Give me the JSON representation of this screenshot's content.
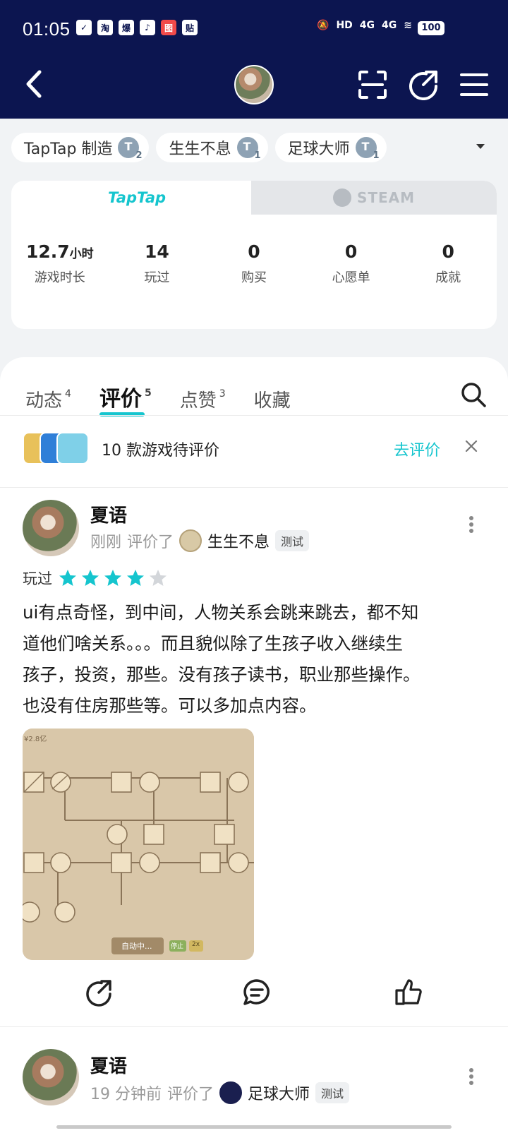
{
  "status_bar": {
    "time": "01:05",
    "app_icons": [
      "淘",
      "爆",
      "♪",
      "图",
      "贴"
    ],
    "network": "4G",
    "battery": "100"
  },
  "nav": {
    "back_icon": "chevron-left-icon",
    "avatar_icon": "avatar",
    "scan_icon": "scan-icon",
    "share_icon": "share-icon",
    "menu_icon": "menu-icon"
  },
  "game_chips": [
    {
      "label": "TapTap 制造",
      "badge": "2"
    },
    {
      "label": "生生不息",
      "badge": "1"
    },
    {
      "label": "足球大师",
      "badge": "1"
    }
  ],
  "platform": {
    "tab_taptap": "TapTap",
    "tab_steam": "STEAM",
    "stats": [
      {
        "value": "12.7",
        "unit": "小时",
        "label": "游戏时长"
      },
      {
        "value": "14",
        "unit": "",
        "label": "玩过"
      },
      {
        "value": "0",
        "unit": "",
        "label": "购买"
      },
      {
        "value": "0",
        "unit": "",
        "label": "心愿单"
      },
      {
        "value": "0",
        "unit": "",
        "label": "成就"
      }
    ]
  },
  "tabs": [
    {
      "label": "动态",
      "count": "4"
    },
    {
      "label": "评价",
      "count": "5",
      "active": true
    },
    {
      "label": "点赞",
      "count": "3"
    },
    {
      "label": "收藏",
      "count": ""
    }
  ],
  "pending": {
    "text": "10 款游戏待评价",
    "action": "去评价"
  },
  "reviews": [
    {
      "name": "夏语",
      "time": "刚刚",
      "verb": "评价了",
      "game": "生生不息",
      "tag": "测试",
      "played_label": "玩过",
      "rating": 4,
      "max_rating": 5,
      "lines": [
        "ui有点奇怪，到中间，人物关系会跳来跳去，都不知",
        "道他们啥关系。。。而且貌似除了生孩子收入继续生",
        "孩子，投资，那些。没有孩子读书，职业那些操作。",
        "也没有住房那些等。可以多加点内容。"
      ],
      "image_caption": "自动中...",
      "image_btn_stop": "停止",
      "image_btn_speed": "2x",
      "image_corner": "¥2.8亿"
    },
    {
      "name": "夏语",
      "time": "19 分钟前",
      "verb": "评价了",
      "game": "足球大师",
      "tag": "测试"
    }
  ],
  "colors": {
    "header_bg": "#0c1550",
    "accent": "#15c5ce",
    "star_off": "#d3d6da"
  }
}
